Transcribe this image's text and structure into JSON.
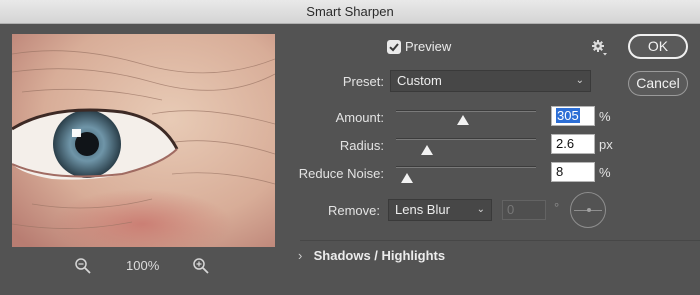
{
  "window": {
    "title": "Smart Sharpen"
  },
  "preview": {
    "zoom_out_icon": "zoom-out-icon",
    "zoom_level": "100%",
    "zoom_in_icon": "zoom-in-icon"
  },
  "preview_toggle": {
    "label": "Preview",
    "checked": true
  },
  "settings_icon": "gear-icon",
  "buttons": {
    "ok": "OK",
    "cancel": "Cancel"
  },
  "preset": {
    "label": "Preset:",
    "value": "Custom"
  },
  "amount": {
    "label": "Amount:",
    "value": "305",
    "unit": "%",
    "slider_fraction": 0.48
  },
  "radius": {
    "label": "Radius:",
    "value": "2.6",
    "unit": "px",
    "slider_fraction": 0.22
  },
  "reduce_noise": {
    "label": "Reduce Noise:",
    "value": "8",
    "unit": "%",
    "slider_fraction": 0.08
  },
  "remove": {
    "label": "Remove:",
    "value": "Lens Blur",
    "angle_value": "0",
    "angle_unit": "°"
  },
  "shadows_highlights": {
    "chevron": "›",
    "label": "Shadows / Highlights"
  },
  "colors": {
    "accent": "#2d6fd6",
    "panel": "#535353",
    "titlebar": "#dcdcdc"
  }
}
